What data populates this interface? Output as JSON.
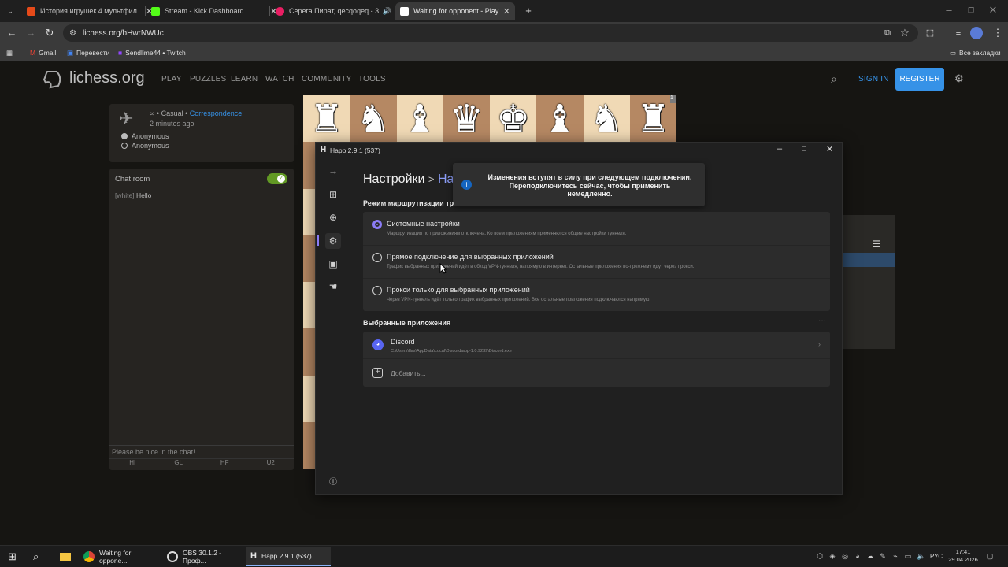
{
  "browser": {
    "tabs": [
      {
        "title": "История игрушек 4 мультфил",
        "favicon_color": "#e64a19",
        "active": false
      },
      {
        "title": "Stream - Kick Dashboard",
        "favicon_color": "#53fc18",
        "active": false
      },
      {
        "title": "Серега Пират, qecqoqeq - 3",
        "favicon_color": "#e91e63",
        "active": false
      },
      {
        "title": "Waiting for opponent - Play An",
        "favicon_color": "#ffffff",
        "active": true
      }
    ],
    "url": "lichess.org/bHwrNWUc",
    "bookmarks": [
      "Gmail",
      "Перевести",
      "Sendlime44 • Twitch"
    ],
    "all_bookmarks": "Все закладки"
  },
  "lichess": {
    "logo": "lichess.org",
    "nav": [
      "PLAY",
      "PUZZLES",
      "LEARN",
      "WATCH",
      "COMMUNITY",
      "TOOLS"
    ],
    "sign_in": "SIGN IN",
    "register": "REGISTER",
    "game": {
      "mode_prefix": "∞ • Casual • ",
      "mode_link": "Correspondence",
      "time": "2 minutes ago",
      "players": [
        "Anonymous",
        "Anonymous"
      ]
    },
    "chat": {
      "title": "Chat room",
      "message_user": "[white]",
      "message_text": "Hello",
      "placeholder": "Please be nice in the chat!",
      "presets": [
        "HI",
        "GL",
        "HF",
        "U2"
      ]
    },
    "board_pieces": [
      "♜",
      "♞",
      "♝",
      "♛",
      "♚",
      "♝",
      "♞",
      "♜"
    ],
    "board_badge": "1"
  },
  "happ": {
    "title": "Happ 2.9.1 (537)",
    "breadcrumb_root": "Настройки",
    "breadcrumb_sep": ">",
    "breadcrumb_current": "На",
    "toast": "Изменения вступят в силу при следующем подключении. Переподключитесь сейчас, чтобы применить немедленно.",
    "routing_label": "Режим маршрутизации тр",
    "options": [
      {
        "title": "Системные настройки",
        "desc": "Маршрутизация по приложениям отключена. Ко всем приложениям применяются общие настройки туннеля.",
        "selected": true
      },
      {
        "title": "Прямое подключение для выбранных приложений",
        "desc": "Трафик выбранных приложений идёт в обход VPN-туннеля, напрямую в интернет. Остальные приложения по-прежнему идут через прокси.",
        "selected": false
      },
      {
        "title": "Прокси только для выбранных приложений",
        "desc": "Через VPN-туннель идёт только трафик выбранных приложений. Все остальные приложения подключаются напрямую.",
        "selected": false
      }
    ],
    "apps_label": "Выбранные приложения",
    "more": "···",
    "app": {
      "name": "Discord",
      "path": "C:\\Users\\Ilas\\AppData\\Local\\Discord\\app-1.0.9239\\Discord.exe"
    },
    "add_label": "Добавить..."
  },
  "taskbar": {
    "apps": [
      "Waiting for oppone...",
      "OBS 30.1.2 - Проф...",
      "Happ 2.9.1 (537)"
    ],
    "lang": "РУС",
    "time": "17:41",
    "date": "29.04.2026"
  }
}
